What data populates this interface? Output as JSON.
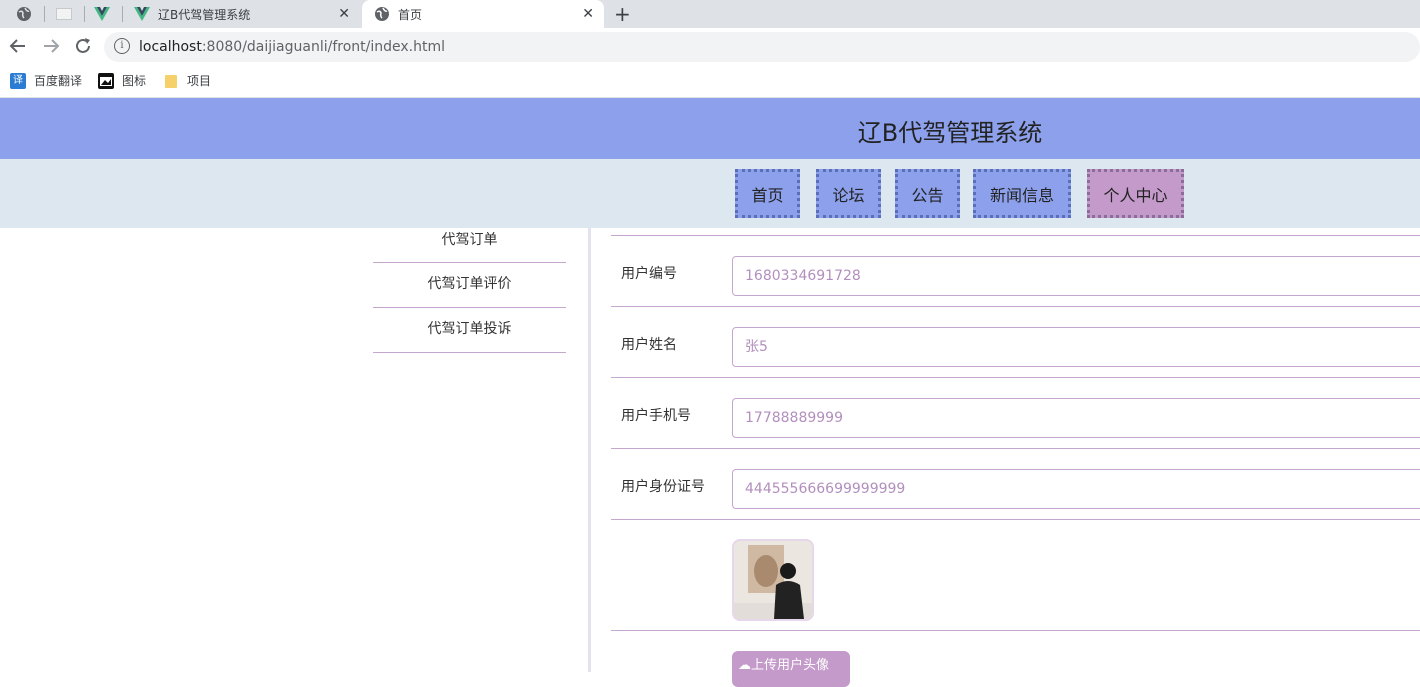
{
  "browser": {
    "tabs": [
      {
        "title": "辽B代驾管理系统"
      },
      {
        "title": "首页"
      }
    ],
    "address": {
      "host": "localhost",
      "rest": ":8080/daijiaguanli/front/index.html"
    },
    "bookmarks": [
      {
        "label": "百度翻译",
        "icon": "translate-icon"
      },
      {
        "label": "图标",
        "icon": "image-icon"
      },
      {
        "label": "项目",
        "icon": "folder-icon"
      }
    ]
  },
  "header": {
    "title": "辽B代驾管理系统"
  },
  "nav": {
    "items": [
      {
        "label": "首页"
      },
      {
        "label": "论坛"
      },
      {
        "label": "公告"
      },
      {
        "label": "新闻信息"
      },
      {
        "label": "个人中心"
      }
    ]
  },
  "sidebar": {
    "items": [
      {
        "label": "代驾订单"
      },
      {
        "label": "代驾订单评价"
      },
      {
        "label": "代驾订单投诉"
      }
    ]
  },
  "form": {
    "fields": [
      {
        "label": "用户编号",
        "value": "1680334691728"
      },
      {
        "label": "用户姓名",
        "value": "张5"
      },
      {
        "label": "用户手机号",
        "value": "17788889999"
      },
      {
        "label": "用户身份证号",
        "value": "444555666699999999"
      }
    ],
    "upload_label": "上传用户头像"
  },
  "colors": {
    "header": "#8ca0ec",
    "nav_bg": "#dce7ef",
    "accent": "#c39ac9",
    "border": "#c5a6cc"
  }
}
